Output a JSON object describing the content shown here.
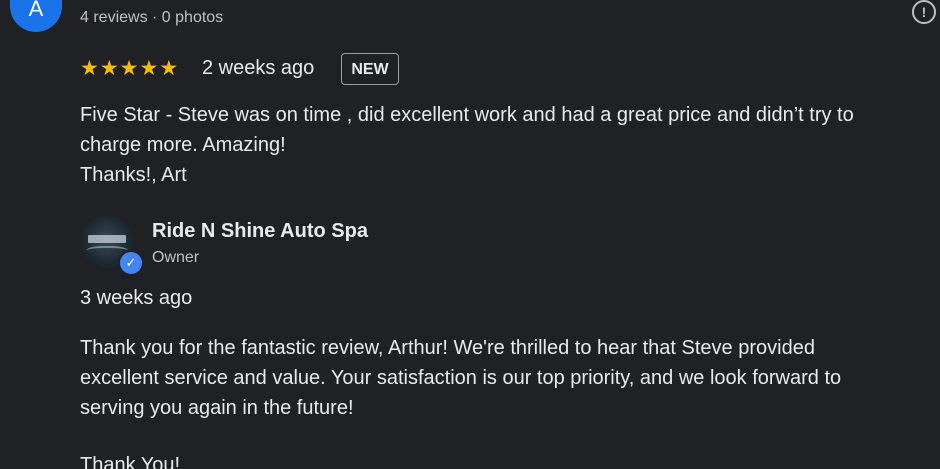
{
  "reviewer": {
    "avatar_letter": "A",
    "meta": "4 reviews · 0 photos"
  },
  "review": {
    "rating": 5,
    "stars": [
      "★",
      "★",
      "★",
      "★",
      "★"
    ],
    "time": "2 weeks ago",
    "badge": "NEW",
    "lines": [
      "Five Star - Steve was on time , did excellent work and had a great price and didn’t try to",
      "charge more. Amazing!",
      "Thanks!, Art"
    ]
  },
  "owner_reply": {
    "name": "Ride N Shine Auto Spa",
    "role": "Owner",
    "time": "3 weeks ago",
    "lines": [
      "Thank you for the fantastic review, Arthur! We're thrilled to hear that Steve provided",
      "excellent service and value. Your satisfaction is our top priority, and we look forward to",
      "serving you again in the future!"
    ],
    "signoff": "Thank You!"
  },
  "icons": {
    "report": "report-flag-icon",
    "verified": "verified-check-icon",
    "star": "star-icon"
  },
  "colors": {
    "background": "#202124",
    "text": "#e8eaed",
    "secondary_text": "#bdc1c6",
    "star": "#fbbc04",
    "avatar": "#1a73e8",
    "verified": "#4285f4"
  }
}
